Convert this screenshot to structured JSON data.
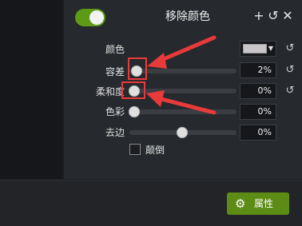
{
  "panel": {
    "title": "移除颜色",
    "enabled": true
  },
  "header_icons": {
    "add": "plus-icon",
    "reset": "reset-icon",
    "close": "close-icon",
    "add_glyph": "+",
    "reset_glyph": "↺",
    "close_glyph": "✕"
  },
  "color_row": {
    "label": "颜色",
    "swatch_color": "#c9c5c9"
  },
  "sliders": [
    {
      "label": "容差",
      "value_text": "2%",
      "value": 0.02
    },
    {
      "label": "柔和度",
      "value_text": "0%",
      "value": 0.0
    },
    {
      "label": "色彩",
      "value_text": "0%",
      "value": 0.0
    },
    {
      "label": "去边",
      "value_text": "0%",
      "value": 0.5
    }
  ],
  "invert": {
    "label": "颠倒",
    "checked": false
  },
  "bottom": {
    "properties_label": "属性"
  },
  "colors": {
    "accent_green": "#5d9b16",
    "highlight_red": "#e83a3a"
  }
}
